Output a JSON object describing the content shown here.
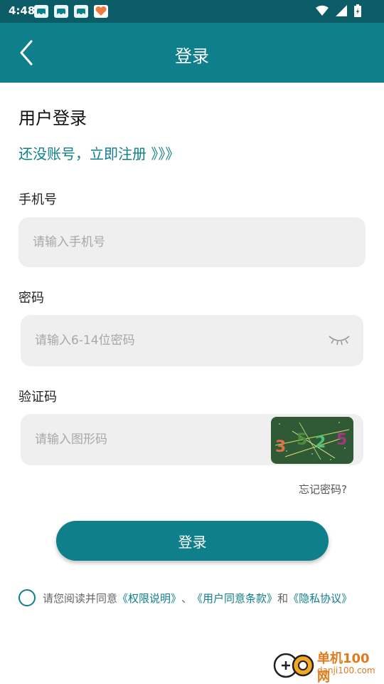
{
  "status_bar": {
    "time": "4:48",
    "notification_icons": [
      "car-notification-icon",
      "car-notification-icon",
      "car-notification-icon",
      "heart-app-icon"
    ],
    "right_icons": [
      "wifi-icon",
      "signal-icon",
      "battery-charging-icon"
    ]
  },
  "app_bar": {
    "back_icon": "chevron-left-icon",
    "title": "登录"
  },
  "heading": "用户登录",
  "register_link": "还没账号，立即注册 》》》",
  "phone": {
    "label": "手机号",
    "placeholder": "请输入手机号",
    "value": ""
  },
  "password": {
    "label": "密码",
    "placeholder": "请输入6-14位密码",
    "value": "",
    "toggle_icon": "eye-closed-icon"
  },
  "captcha": {
    "label": "验证码",
    "placeholder": "请输入图形码",
    "value": "",
    "image_digits": [
      "3",
      "5",
      "2",
      "5"
    ]
  },
  "forgot_password": "忘记密码?",
  "login_button": "登录",
  "agreement": {
    "prefix": "请您阅读并同意",
    "link1": "《权限说明》",
    "sep": "、",
    "link2": "《用户同意条款》",
    "and": "和",
    "link3": "《隐私协议》"
  },
  "watermark": {
    "name": "单机100网",
    "url": "danji100.com"
  },
  "colors": {
    "accent": "#0f7f8b",
    "status_bar": "#0b5c66",
    "input_bg": "#efefef"
  }
}
